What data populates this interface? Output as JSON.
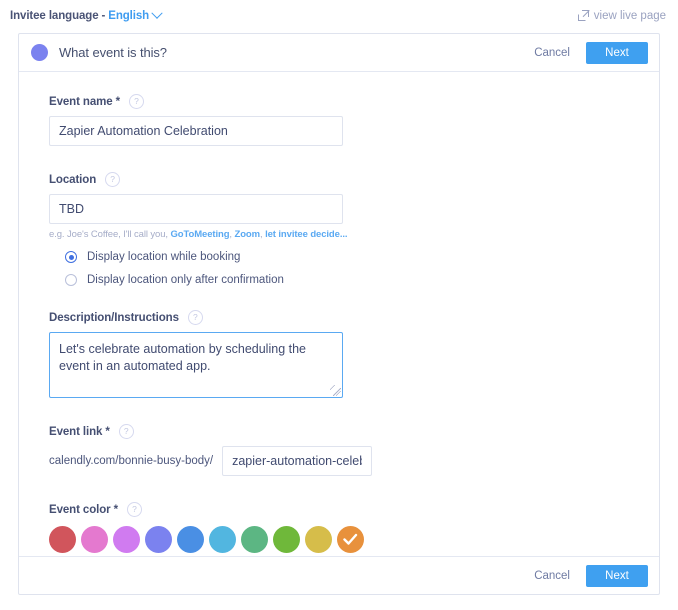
{
  "topbar": {
    "invitee_language_label": "Invitee language",
    "separator": "-",
    "language_value": "English",
    "view_live_page": "view live page"
  },
  "card": {
    "header": {
      "title": "What event is this?",
      "cancel_label": "Cancel",
      "next_label": "Next",
      "step_dot_color": "#7b82ef"
    },
    "footer": {
      "cancel_label": "Cancel",
      "next_label": "Next"
    },
    "fields": {
      "event_name": {
        "label": "Event name *",
        "help": "?",
        "value": "Zapier Automation Celebration"
      },
      "location": {
        "label": "Location",
        "help": "?",
        "value": "TBD",
        "hint_prefix": "e.g. Joe's Coffee, I'll call you, ",
        "hint_links": [
          "GoToMeeting",
          "Zoom",
          "let invitee decide..."
        ],
        "radios": [
          {
            "label": "Display location while booking",
            "selected": true
          },
          {
            "label": "Display location only after confirmation",
            "selected": false
          }
        ]
      },
      "description": {
        "label": "Description/Instructions",
        "help": "?",
        "value": "Let's celebrate automation by scheduling the event in an automated app."
      },
      "event_link": {
        "label": "Event link *",
        "help": "?",
        "prefix": "calendly.com/bonnie-busy-body/",
        "value": "zapier-automation-celebration"
      },
      "event_color": {
        "label": "Event color *",
        "help": "?",
        "selected_index": 9,
        "swatches": [
          "#d1555c",
          "#e479cf",
          "#d07bf0",
          "#7b82ef",
          "#4a8fe4",
          "#52b6e0",
          "#5cb683",
          "#6fb83a",
          "#d6bd4a",
          "#e8913c"
        ]
      }
    }
  }
}
